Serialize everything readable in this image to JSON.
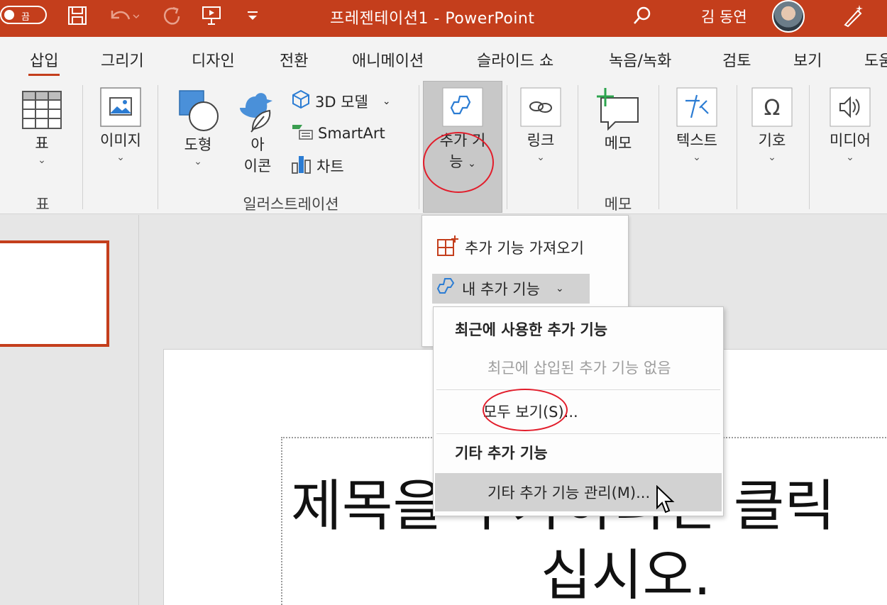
{
  "titlebar": {
    "autosave_label": "끔",
    "title": "프레젠테이션1  -  PowerPoint",
    "user": "김 동연"
  },
  "tabs": [
    "삽입",
    "그리기",
    "디자인",
    "전환",
    "애니메이션",
    "슬라이드 쇼",
    "녹음/녹화",
    "검토",
    "보기",
    "도움"
  ],
  "ribbon": {
    "table": {
      "label": "표",
      "group": "표"
    },
    "image": {
      "label": "이미지"
    },
    "shapes": {
      "label": "도형"
    },
    "icons": {
      "label1": "아",
      "label2": "이콘"
    },
    "model3d": {
      "label": "3D 모델"
    },
    "smartart": {
      "label": "SmartArt"
    },
    "chart": {
      "label": "차트"
    },
    "illustration_group": "일러스트레이션",
    "addins": {
      "label1": "추가 기",
      "label2": "능"
    },
    "link": {
      "label": "링크"
    },
    "comment": {
      "label": "메모",
      "group": "메모"
    },
    "text": {
      "label": "텍스트"
    },
    "symbol": {
      "label": "기호"
    },
    "media": {
      "label": "미디어"
    }
  },
  "addins_menu": {
    "get_addins": "추가 기능 가져오기",
    "my_addins": "내 추가 기능"
  },
  "my_addins_menu": {
    "recent_header": "최근에 사용한 추가 기능",
    "recent_empty": "최근에 삽입된 추가 기능 없음",
    "view_all": "모두 보기(S)...",
    "other_header": "기타 추가 기능",
    "manage_other": "기타 추가 기능 관리(M)..."
  },
  "slide": {
    "title_line1": "제목을 추가하려면 클릭",
    "title_line2": "십시오."
  },
  "colors": {
    "accent": "#c43e1c",
    "highlight_ring": "#e21d2b",
    "icon_blue": "#2b7cd3"
  }
}
